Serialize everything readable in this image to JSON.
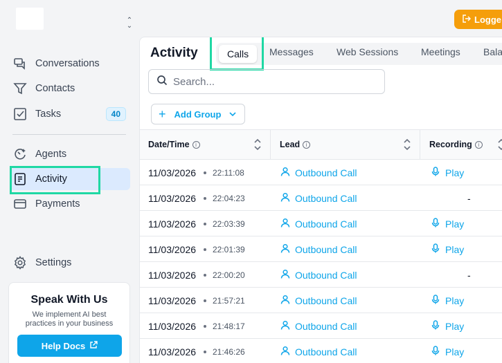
{
  "sidebar": {
    "items": [
      {
        "label": "Conversations",
        "icon": "chat-icon"
      },
      {
        "label": "Contacts",
        "icon": "filter-icon"
      },
      {
        "label": "Tasks",
        "icon": "checkbox-icon",
        "badge": "40"
      },
      {
        "label": "Agents",
        "icon": "agents-icon"
      },
      {
        "label": "Activity",
        "icon": "document-icon"
      },
      {
        "label": "Payments",
        "icon": "card-icon"
      },
      {
        "label": "Settings",
        "icon": "gear-icon"
      }
    ],
    "card": {
      "title": "Speak With Us",
      "subtitle": "We implement AI best practices in your business",
      "button": "Help Docs"
    }
  },
  "header": {
    "logged_label": "Logge"
  },
  "main": {
    "title": "Activity",
    "tabs": [
      "Calls",
      "Messages",
      "Web Sessions",
      "Meetings",
      "Bala"
    ],
    "active_tab": "Calls",
    "search_placeholder": "Search...",
    "add_group_label": "Add Group",
    "columns": [
      "Date/Time",
      "Lead",
      "Recording"
    ],
    "rows": [
      {
        "date": "11/03/2026",
        "time": "22:11:08",
        "lead": "Outbound Call",
        "recording": "Play"
      },
      {
        "date": "11/03/2026",
        "time": "22:04:23",
        "lead": "Outbound Call",
        "recording": "-"
      },
      {
        "date": "11/03/2026",
        "time": "22:03:39",
        "lead": "Outbound Call",
        "recording": "Play"
      },
      {
        "date": "11/03/2026",
        "time": "22:01:39",
        "lead": "Outbound Call",
        "recording": "Play"
      },
      {
        "date": "11/03/2026",
        "time": "22:00:20",
        "lead": "Outbound Call",
        "recording": "-"
      },
      {
        "date": "11/03/2026",
        "time": "21:57:21",
        "lead": "Outbound Call",
        "recording": "Play"
      },
      {
        "date": "11/03/2026",
        "time": "21:48:17",
        "lead": "Outbound Call",
        "recording": "Play"
      },
      {
        "date": "11/03/2026",
        "time": "21:46:26",
        "lead": "Outbound Call",
        "recording": "Play"
      }
    ]
  },
  "colors": {
    "accent": "#0ea5e9",
    "highlight": "#1fd8a4",
    "logged_button": "#f59e0b",
    "active_nav": "#dbeafe"
  }
}
